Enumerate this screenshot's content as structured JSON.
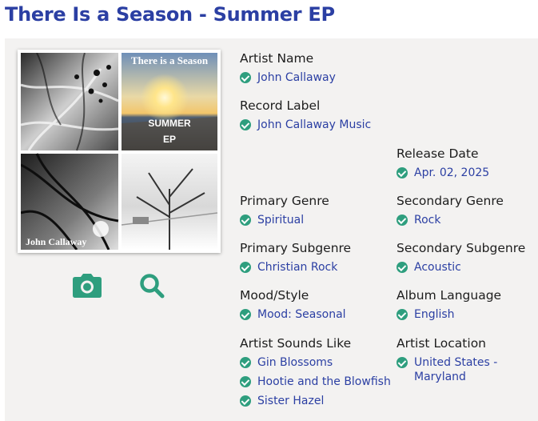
{
  "page": {
    "title": "There Is a Season - Summer EP"
  },
  "cover": {
    "top_right_text": "There is a Season",
    "center_line1": "SUMMER",
    "center_line2": "EP",
    "artist_overlay": "John Callaway"
  },
  "icons": {
    "camera": "camera-icon",
    "search": "search-icon",
    "check": "check-circle-icon"
  },
  "colors": {
    "title": "#2b3fa3",
    "link": "#2b3fa3",
    "check": "#2e9e7e",
    "panel": "#f3f2f1"
  },
  "details": {
    "artist_name": {
      "label": "Artist Name",
      "values": [
        "John Callaway"
      ]
    },
    "record_label": {
      "label": "Record Label",
      "values": [
        "John Callaway Music"
      ]
    },
    "release_date": {
      "label": "Release Date",
      "values": [
        "Apr. 02, 2025"
      ]
    },
    "primary_genre": {
      "label": "Primary Genre",
      "values": [
        "Spiritual"
      ]
    },
    "secondary_genre": {
      "label": "Secondary Genre",
      "values": [
        "Rock"
      ]
    },
    "primary_subgenre": {
      "label": "Primary Subgenre",
      "values": [
        "Christian Rock"
      ]
    },
    "secondary_subgenre": {
      "label": "Secondary Subgenre",
      "values": [
        "Acoustic"
      ]
    },
    "mood_style": {
      "label": "Mood/Style",
      "values": [
        "Mood: Seasonal"
      ]
    },
    "album_language": {
      "label": "Album Language",
      "values": [
        "English"
      ]
    },
    "artist_sounds_like": {
      "label": "Artist Sounds Like",
      "values": [
        "Gin Blossoms",
        "Hootie and the Blowfish",
        "Sister Hazel"
      ]
    },
    "artist_location": {
      "label": "Artist Location",
      "values": [
        "United States - Maryland"
      ]
    }
  }
}
